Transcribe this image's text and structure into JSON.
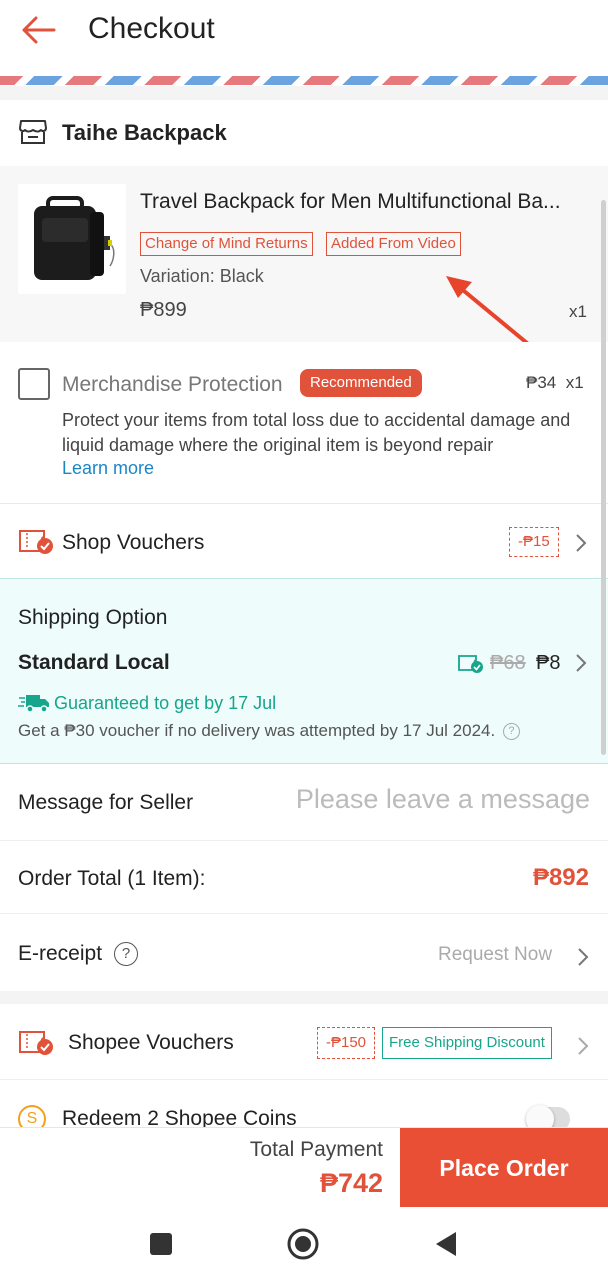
{
  "header": {
    "title": "Checkout",
    "back_icon": "arrow-left-icon"
  },
  "shop": {
    "name": "Taihe Backpack",
    "icon": "store-icon"
  },
  "product": {
    "title": "Travel Backpack for Men Multifunctional Ba...",
    "tags": [
      "Change of Mind Returns",
      "Added From Video"
    ],
    "variation": "Variation: Black",
    "price": "₱899",
    "quantity": "x1"
  },
  "protection": {
    "title": "Merchandise Protection",
    "badge": "Recommended",
    "price": "₱34",
    "quantity": "x1",
    "description": "Protect your items from total loss due to accidental damage and liquid damage where the original item is beyond repair",
    "learn_more": "Learn more",
    "checked": false
  },
  "shop_vouchers": {
    "label": "Shop Vouchers",
    "discount": "-₱15"
  },
  "shipping": {
    "label": "Shipping Option",
    "method": "Standard Local",
    "original_price": "₱68",
    "price": "₱8",
    "guarantee": "Guaranteed to get by 17 Jul",
    "note": "Get a ₱30 voucher if no delivery was attempted by 17 Jul 2024."
  },
  "message": {
    "label": "Message for Seller",
    "placeholder": "Please leave a message"
  },
  "order_total": {
    "label": "Order Total (1 Item):",
    "value": "₱892"
  },
  "ereceipt": {
    "label": "E-receipt",
    "help": "?",
    "action": "Request Now"
  },
  "shopee_vouchers": {
    "label": "Shopee Vouchers",
    "discount": "-₱150",
    "free_shipping": "Free Shipping Discount"
  },
  "coins": {
    "label": "Redeem 2 Shopee Coins",
    "icon_char": "S",
    "enabled": false
  },
  "footer": {
    "total_label": "Total Payment",
    "total_value": "₱742",
    "place_order": "Place Order"
  },
  "colors": {
    "accent": "#e94f34",
    "teal": "#17a58b",
    "link": "#1b86c6"
  }
}
